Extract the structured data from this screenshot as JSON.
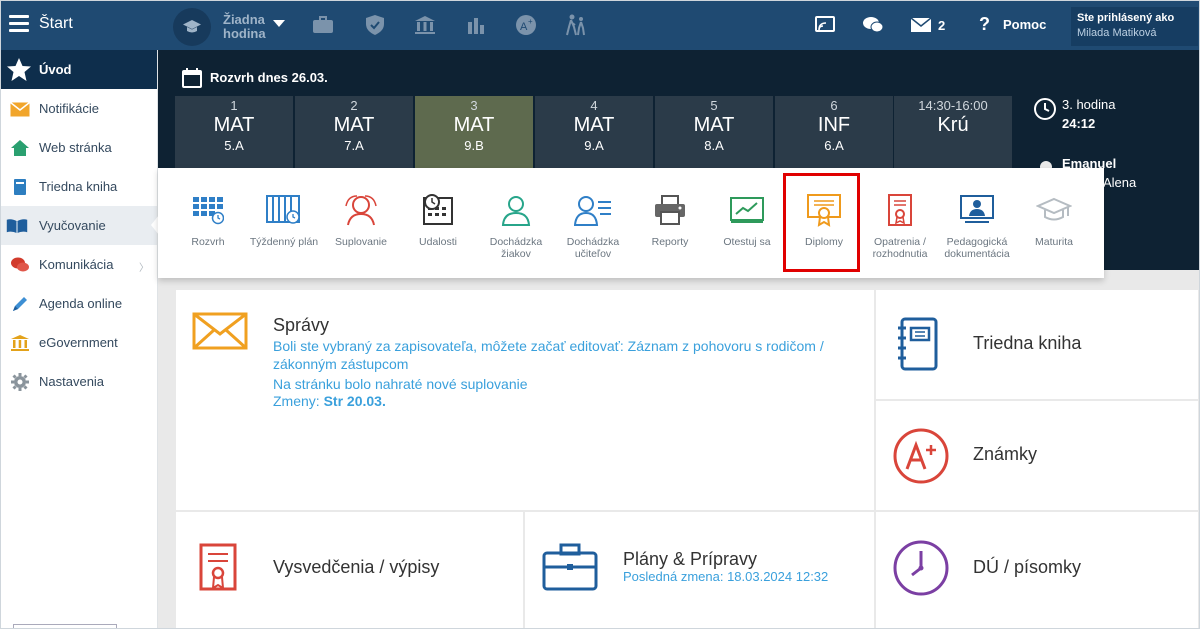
{
  "topbar": {
    "start_label": "Štart",
    "hour_line1": "Žiadna",
    "hour_line2": "hodina",
    "mail_count": "2",
    "help_label": "Pomoc",
    "user_line1": "Ste prihlásený ako",
    "user_line2": "Milada Matiková"
  },
  "sidebar": {
    "items": [
      {
        "label": "Úvod",
        "icon": "star-icon"
      },
      {
        "label": "Notifikácie",
        "icon": "envelope-icon"
      },
      {
        "label": "Web stránka",
        "icon": "house-icon"
      },
      {
        "label": "Triedna kniha",
        "icon": "book-icon"
      },
      {
        "label": "Vyučovanie",
        "icon": "open-book-icon"
      },
      {
        "label": "Komunikácia",
        "icon": "chat-icon"
      },
      {
        "label": "Agenda online",
        "icon": "pen-icon"
      },
      {
        "label": "eGovernment",
        "icon": "bank-icon"
      },
      {
        "label": "Nastavenia",
        "icon": "gear-icon"
      }
    ]
  },
  "schedule": {
    "title": "Rozvrh dnes 26.03.",
    "lessons": [
      {
        "num": "1",
        "subject": "MAT",
        "class": "5.A"
      },
      {
        "num": "2",
        "subject": "MAT",
        "class": "7.A"
      },
      {
        "num": "3",
        "subject": "MAT",
        "class": "9.B"
      },
      {
        "num": "4",
        "subject": "MAT",
        "class": "9.A"
      },
      {
        "num": "5",
        "subject": "MAT",
        "class": "8.A"
      },
      {
        "num": "6",
        "subject": "INF",
        "class": "6.A"
      },
      {
        "num": "14:30-16:00",
        "subject": "Krú",
        "class": ""
      }
    ],
    "current_hour": "3. hodina",
    "time_left": "24:12",
    "person_1": "Emanuel",
    "person_2": "Alena"
  },
  "flyout": {
    "items": [
      {
        "label": "Rozvrh"
      },
      {
        "label": "Týždenný plán"
      },
      {
        "label": "Suplovanie"
      },
      {
        "label": "Udalosti"
      },
      {
        "label": "Dochádzka žiakov"
      },
      {
        "label": "Dochádzka učiteľov"
      },
      {
        "label": "Reporty"
      },
      {
        "label": "Otestuj sa"
      },
      {
        "label": "Diplomy"
      },
      {
        "label": "Opatrenia / rozhodnutia"
      },
      {
        "label": "Pedagogická dokumentácia"
      },
      {
        "label": "Maturita"
      }
    ]
  },
  "cards": {
    "spravy": {
      "title": "Správy",
      "line1": "Boli ste vybraný za zapisovateľa, môžete začať editovať: Záznam z pohovoru s rodičom / zákonným zástupcom",
      "line2": "Na stránku bolo nahraté nové suplovanie",
      "line3_prefix": "Zmeny: ",
      "line3_bold": "Str 20.03."
    },
    "triedna_kniha": "Triedna kniha",
    "znamky": "Známky",
    "vysvedcenia": "Vysvedčenia / výpisy",
    "plany": {
      "title": "Plány & Prípravy",
      "sub": "Posledná zmena: 18.03.2024 12:32"
    },
    "du": "DÚ / písomky"
  },
  "colors": {
    "topbar": "#1f4a72",
    "dark_panel": "#0e2233",
    "link": "#3aa0dc",
    "highlight": "#e00000"
  }
}
